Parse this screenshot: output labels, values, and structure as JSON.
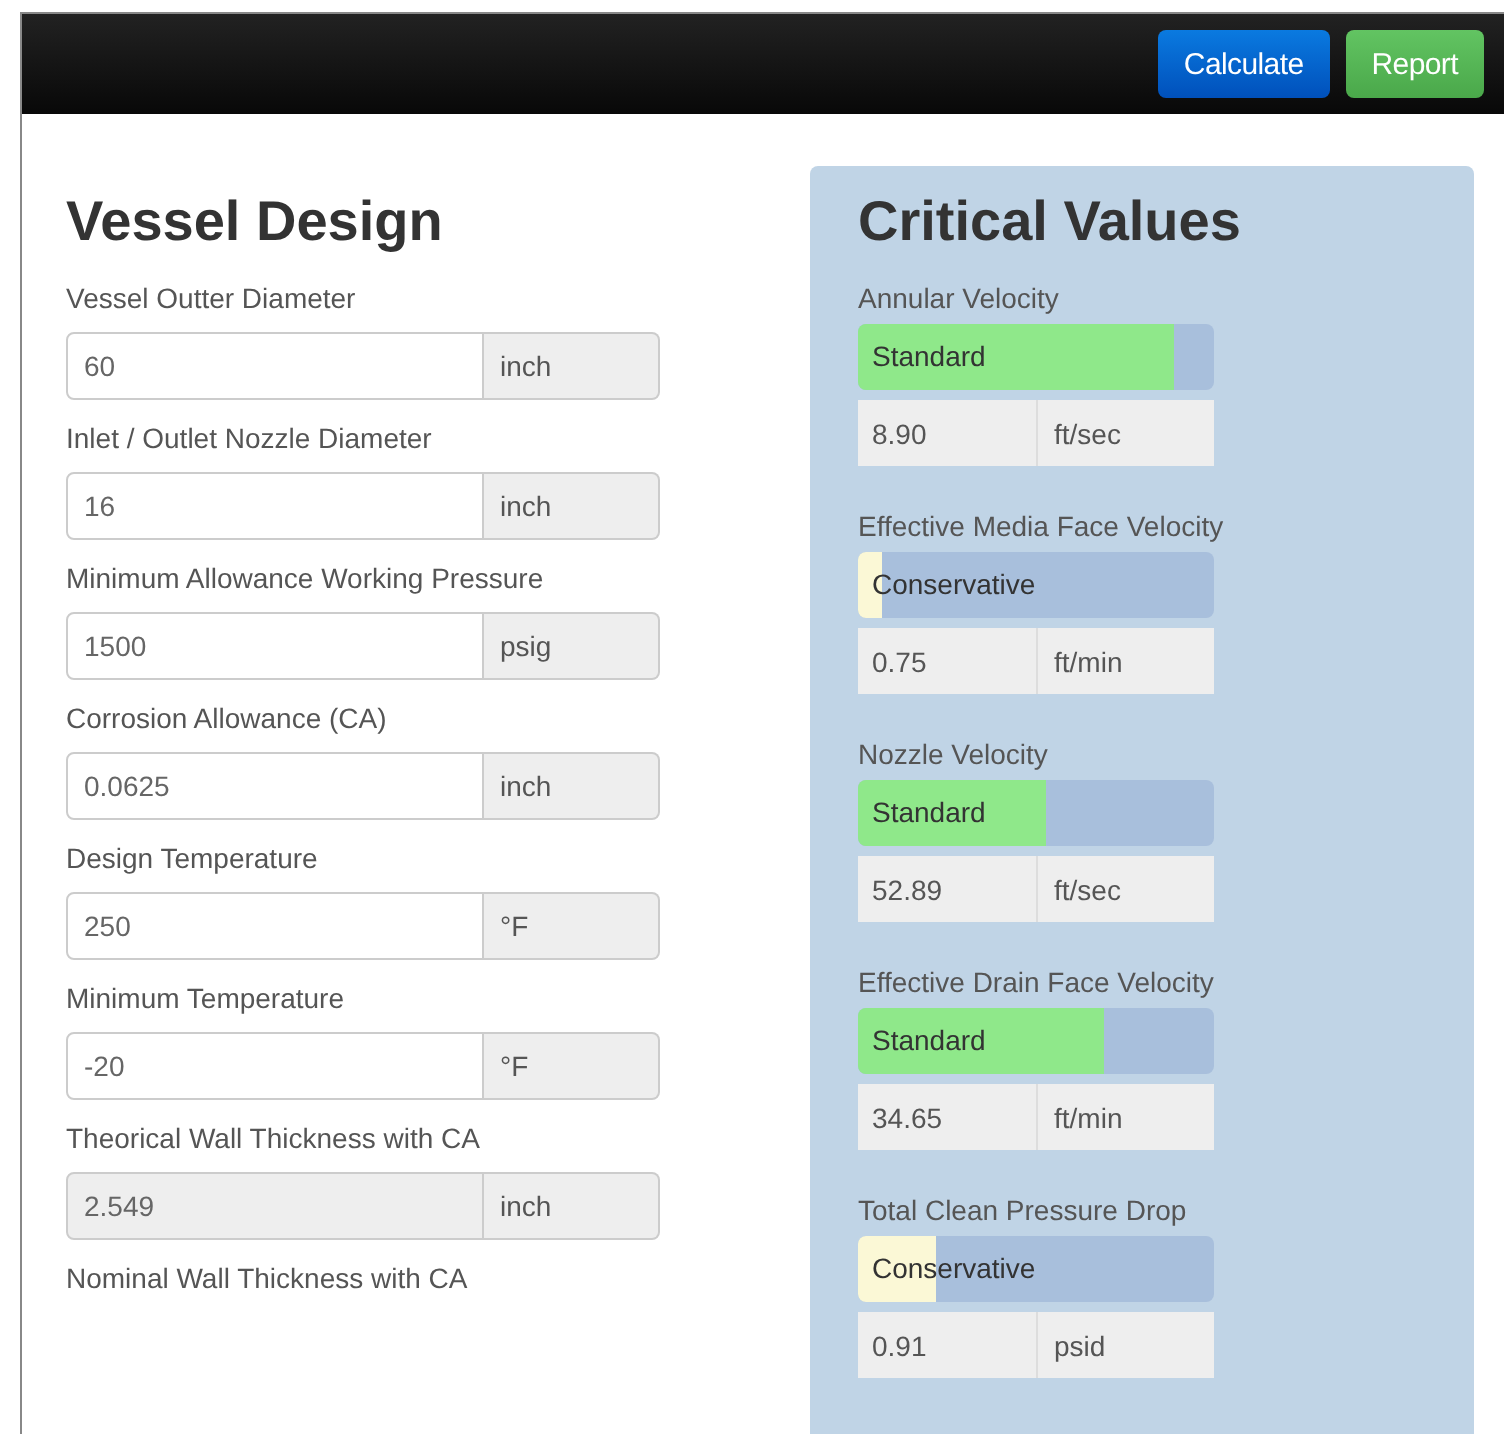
{
  "toolbar": {
    "buttons": [
      {
        "label": "Calculate",
        "kind": "primary"
      },
      {
        "label": "Report",
        "kind": "success"
      }
    ]
  },
  "vessel_design": {
    "title": "Vessel Design",
    "fields": [
      {
        "label": "Vessel Outter Diameter",
        "value": "60",
        "unit": "inch",
        "readonly": false
      },
      {
        "label": "Inlet / Outlet Nozzle Diameter",
        "value": "16",
        "unit": "inch",
        "readonly": false
      },
      {
        "label": "Minimum Allowance Working Pressure",
        "value": "1500",
        "unit": "psig",
        "readonly": false
      },
      {
        "label": "Corrosion Allowance (CA)",
        "value": "0.0625",
        "unit": "inch",
        "readonly": false
      },
      {
        "label": "Design Temperature",
        "value": "250",
        "unit": "°F",
        "readonly": false
      },
      {
        "label": "Minimum Temperature",
        "value": "-20",
        "unit": "°F",
        "readonly": false
      },
      {
        "label": "Theorical Wall Thickness with CA",
        "value": "2.549",
        "unit": "inch",
        "readonly": true
      },
      {
        "label": "Nominal Wall Thickness with CA"
      }
    ]
  },
  "critical_values": {
    "title": "Critical Values",
    "items": [
      {
        "label": "Annular Velocity",
        "status": "Standard",
        "color": "#8fe88a",
        "level": 0.89,
        "value": "8.90",
        "unit": "ft/sec"
      },
      {
        "label": "Effective Media Face Velocity",
        "status": "Conservative",
        "color": "#fbf8d6",
        "level": 0.07,
        "value": "0.75",
        "unit": "ft/min"
      },
      {
        "label": "Nozzle Velocity",
        "status": "Standard",
        "color": "#8fe88a",
        "level": 0.53,
        "value": "52.89",
        "unit": "ft/sec"
      },
      {
        "label": "Effective Drain Face Velocity",
        "status": "Standard",
        "color": "#8fe88a",
        "level": 0.69,
        "value": "34.65",
        "unit": "ft/min"
      },
      {
        "label": "Total Clean Pressure Drop",
        "status": "Conservative",
        "color": "#fbf8d6",
        "level": 0.22,
        "value": "0.91",
        "unit": "psid"
      }
    ]
  }
}
